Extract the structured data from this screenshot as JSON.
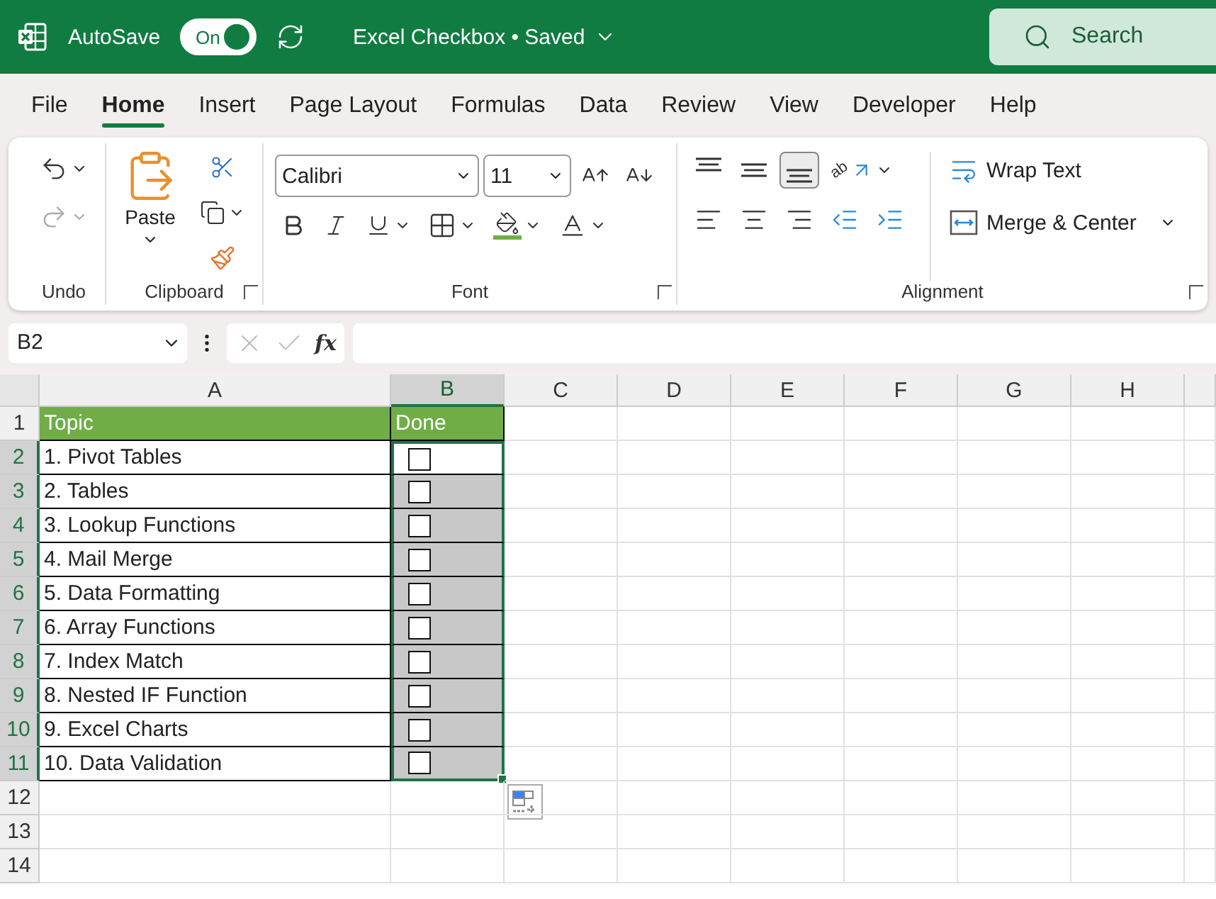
{
  "title_bar": {
    "autosave_label": "AutoSave",
    "autosave_on": true,
    "toggle_label": "On",
    "document_title": "Excel Checkbox • Saved",
    "search_placeholder": "Search"
  },
  "tabs": [
    {
      "label": "File",
      "selected": false
    },
    {
      "label": "Home",
      "selected": true
    },
    {
      "label": "Insert",
      "selected": false
    },
    {
      "label": "Page Layout",
      "selected": false
    },
    {
      "label": "Formulas",
      "selected": false
    },
    {
      "label": "Data",
      "selected": false
    },
    {
      "label": "Review",
      "selected": false
    },
    {
      "label": "View",
      "selected": false
    },
    {
      "label": "Developer",
      "selected": false
    },
    {
      "label": "Help",
      "selected": false
    }
  ],
  "ribbon": {
    "undo": {
      "label": "Undo"
    },
    "clipboard": {
      "label": "Clipboard",
      "paste": "Paste"
    },
    "font": {
      "label": "Font",
      "font_name": "Calibri",
      "font_size": "11"
    },
    "alignment": {
      "label": "Alignment",
      "orientation_glyph": "ab",
      "wrap_text": "Wrap Text",
      "merge_center": "Merge & Center",
      "vertical_buttons": [
        {
          "kind": "top",
          "selected": false
        },
        {
          "kind": "middle",
          "selected": false
        },
        {
          "kind": "bottom",
          "selected": true
        }
      ]
    }
  },
  "formula_bar": {
    "name_box": "B2",
    "fx": "fx"
  },
  "sheet": {
    "columns": [
      {
        "label": "A",
        "selected": false
      },
      {
        "label": "B",
        "selected": true
      },
      {
        "label": "C",
        "selected": false
      },
      {
        "label": "D",
        "selected": false
      },
      {
        "label": "E",
        "selected": false
      },
      {
        "label": "F",
        "selected": false
      },
      {
        "label": "G",
        "selected": false
      },
      {
        "label": "H",
        "selected": false
      }
    ],
    "rows": [
      {
        "number": "1",
        "kind": "header",
        "selected": false,
        "topic": "Topic",
        "done": "Done"
      },
      {
        "number": "2",
        "kind": "item",
        "selected": true,
        "active": true,
        "topic": "1. Pivot Tables",
        "checked": false
      },
      {
        "number": "3",
        "kind": "item",
        "selected": true,
        "active": false,
        "topic": "2. Tables",
        "checked": false
      },
      {
        "number": "4",
        "kind": "item",
        "selected": true,
        "active": false,
        "topic": "3. Lookup Functions",
        "checked": false
      },
      {
        "number": "5",
        "kind": "item",
        "selected": true,
        "active": false,
        "topic": "4. Mail Merge",
        "checked": false
      },
      {
        "number": "6",
        "kind": "item",
        "selected": true,
        "active": false,
        "topic": "5. Data Formatting",
        "checked": false
      },
      {
        "number": "7",
        "kind": "item",
        "selected": true,
        "active": false,
        "topic": "6. Array Functions",
        "checked": false
      },
      {
        "number": "8",
        "kind": "item",
        "selected": true,
        "active": false,
        "topic": "7. Index Match",
        "checked": false
      },
      {
        "number": "9",
        "kind": "item",
        "selected": true,
        "active": false,
        "topic": "8. Nested IF Function",
        "checked": false
      },
      {
        "number": "10",
        "kind": "item",
        "selected": true,
        "active": false,
        "topic": "9. Excel Charts",
        "checked": false
      },
      {
        "number": "11",
        "kind": "item",
        "selected": true,
        "active": false,
        "topic": "10. Data Validation",
        "checked": false
      },
      {
        "number": "12",
        "kind": "empty",
        "selected": false
      },
      {
        "number": "13",
        "kind": "empty",
        "selected": false
      },
      {
        "number": "14",
        "kind": "empty",
        "selected": false
      }
    ]
  }
}
